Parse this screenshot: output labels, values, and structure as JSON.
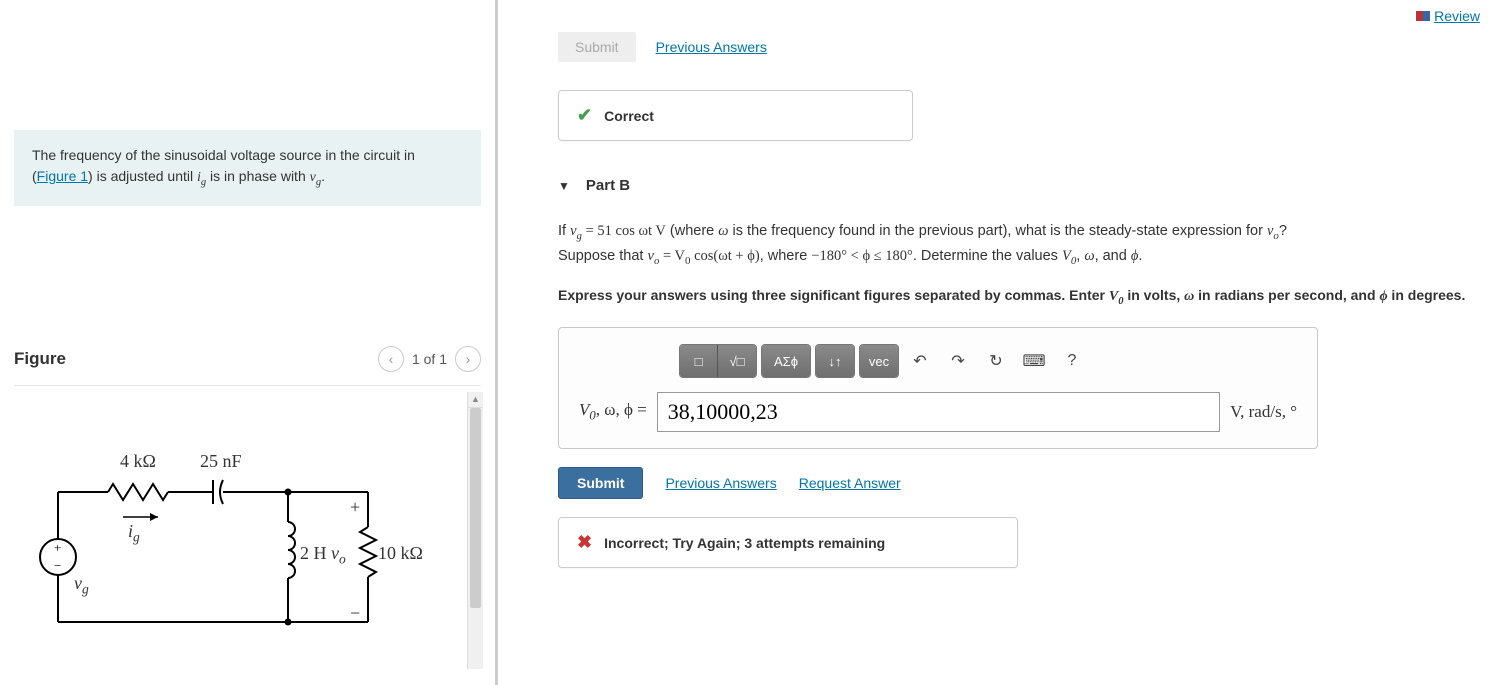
{
  "review": {
    "label": "Review"
  },
  "problem": {
    "text_before_link": "The frequency of the sinusoidal voltage source in the circuit in (",
    "figure_link": "Figure 1",
    "text_after_link": ") is adjusted until ",
    "ig": "i",
    "ig_sub": "g",
    "text_mid": " is in phase with ",
    "vg": "v",
    "vg_sub": "g",
    "text_end": "."
  },
  "figure": {
    "title": "Figure",
    "counter": "1 of 1",
    "labels": {
      "r1": "4 kΩ",
      "c1": "25 nF",
      "ig": "i",
      "ig_sub": "g",
      "vg": "v",
      "vg_sub": "g",
      "l1": "2 H",
      "vo": "v",
      "vo_sub": "o",
      "r2": "10 kΩ",
      "plus": "+",
      "minus": "−"
    }
  },
  "part_a": {
    "submit_label": "Submit",
    "prev_answers": "Previous Answers",
    "feedback": "Correct"
  },
  "part_b": {
    "header": "Part B",
    "q_line1_a": "If ",
    "q_vg": "v",
    "q_vg_sub": "g",
    "q_eq": " = 51 cos ωt V",
    "q_line1_b": " (where ",
    "q_omega": "ω",
    "q_line1_c": " is the frequency found in the previous part), what is the steady-state expression for ",
    "q_vo": "v",
    "q_vo_sub": "o",
    "q_line1_d": "?",
    "q_line2_a": "Suppose that ",
    "q_vo2": "v",
    "q_vo2_sub": "o",
    "q_eq2": " = V",
    "q_V0_sub": "0",
    "q_cos": " cos(ωt + ϕ)",
    "q_line2_b": ", where ",
    "q_range": "−180° < ϕ ≤ 180°",
    "q_line2_c": ". Determine the values ",
    "q_V0": "V",
    "q_V0s": "0",
    "q_comma1": ", ",
    "q_w": "ω",
    "q_comma2": ", and ",
    "q_phi": "ϕ",
    "q_period": ".",
    "instruction_a": "Express your answers using three significant figures separated by commas. Enter ",
    "instr_V0": "V",
    "instr_V0_sub": "0",
    "instruction_b": " in volts, ",
    "instr_w": "ω",
    "instruction_c": " in radians per second, and ",
    "instr_phi": "ϕ",
    "instruction_d": " in degrees.",
    "toolbar": {
      "templates": "□",
      "fraction": "√□",
      "greek": "ΑΣϕ",
      "subscript": "↓↑",
      "vec": "vec",
      "undo": "↶",
      "redo": "↷",
      "reset": "↻",
      "keyboard": "⌨",
      "help": "?"
    },
    "answer_label_a": "V",
    "answer_label_sub": "0",
    "answer_label_b": ", ω, ϕ = ",
    "answer_value": "38,10000,23",
    "units": "V, rad/s, °",
    "submit_label": "Submit",
    "prev_answers": "Previous Answers",
    "request_answer": "Request Answer",
    "feedback": "Incorrect; Try Again; 3 attempts remaining"
  }
}
